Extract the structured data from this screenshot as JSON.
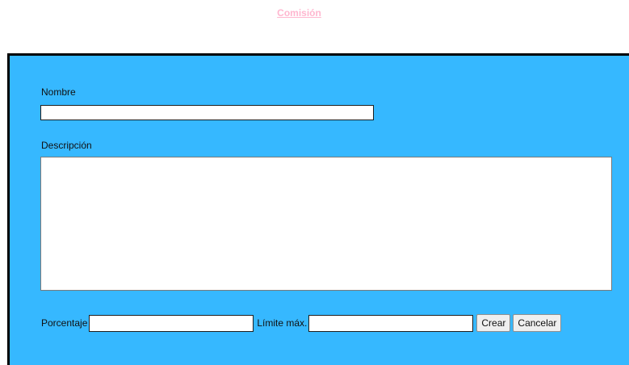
{
  "header": {
    "title": "Comisión"
  },
  "form": {
    "nombre_label": "Nombre",
    "nombre_value": "",
    "descripcion_label": "Descripción",
    "descripcion_value": "",
    "porcentaje_label": "Porcentaje",
    "porcentaje_value": "",
    "limite_label": "Límite máx.",
    "limite_value": "",
    "crear_label": "Crear",
    "cancelar_label": "Cancelar"
  },
  "colors": {
    "panel_background": "#36b8ff",
    "title_color": "#ffb6cf"
  }
}
